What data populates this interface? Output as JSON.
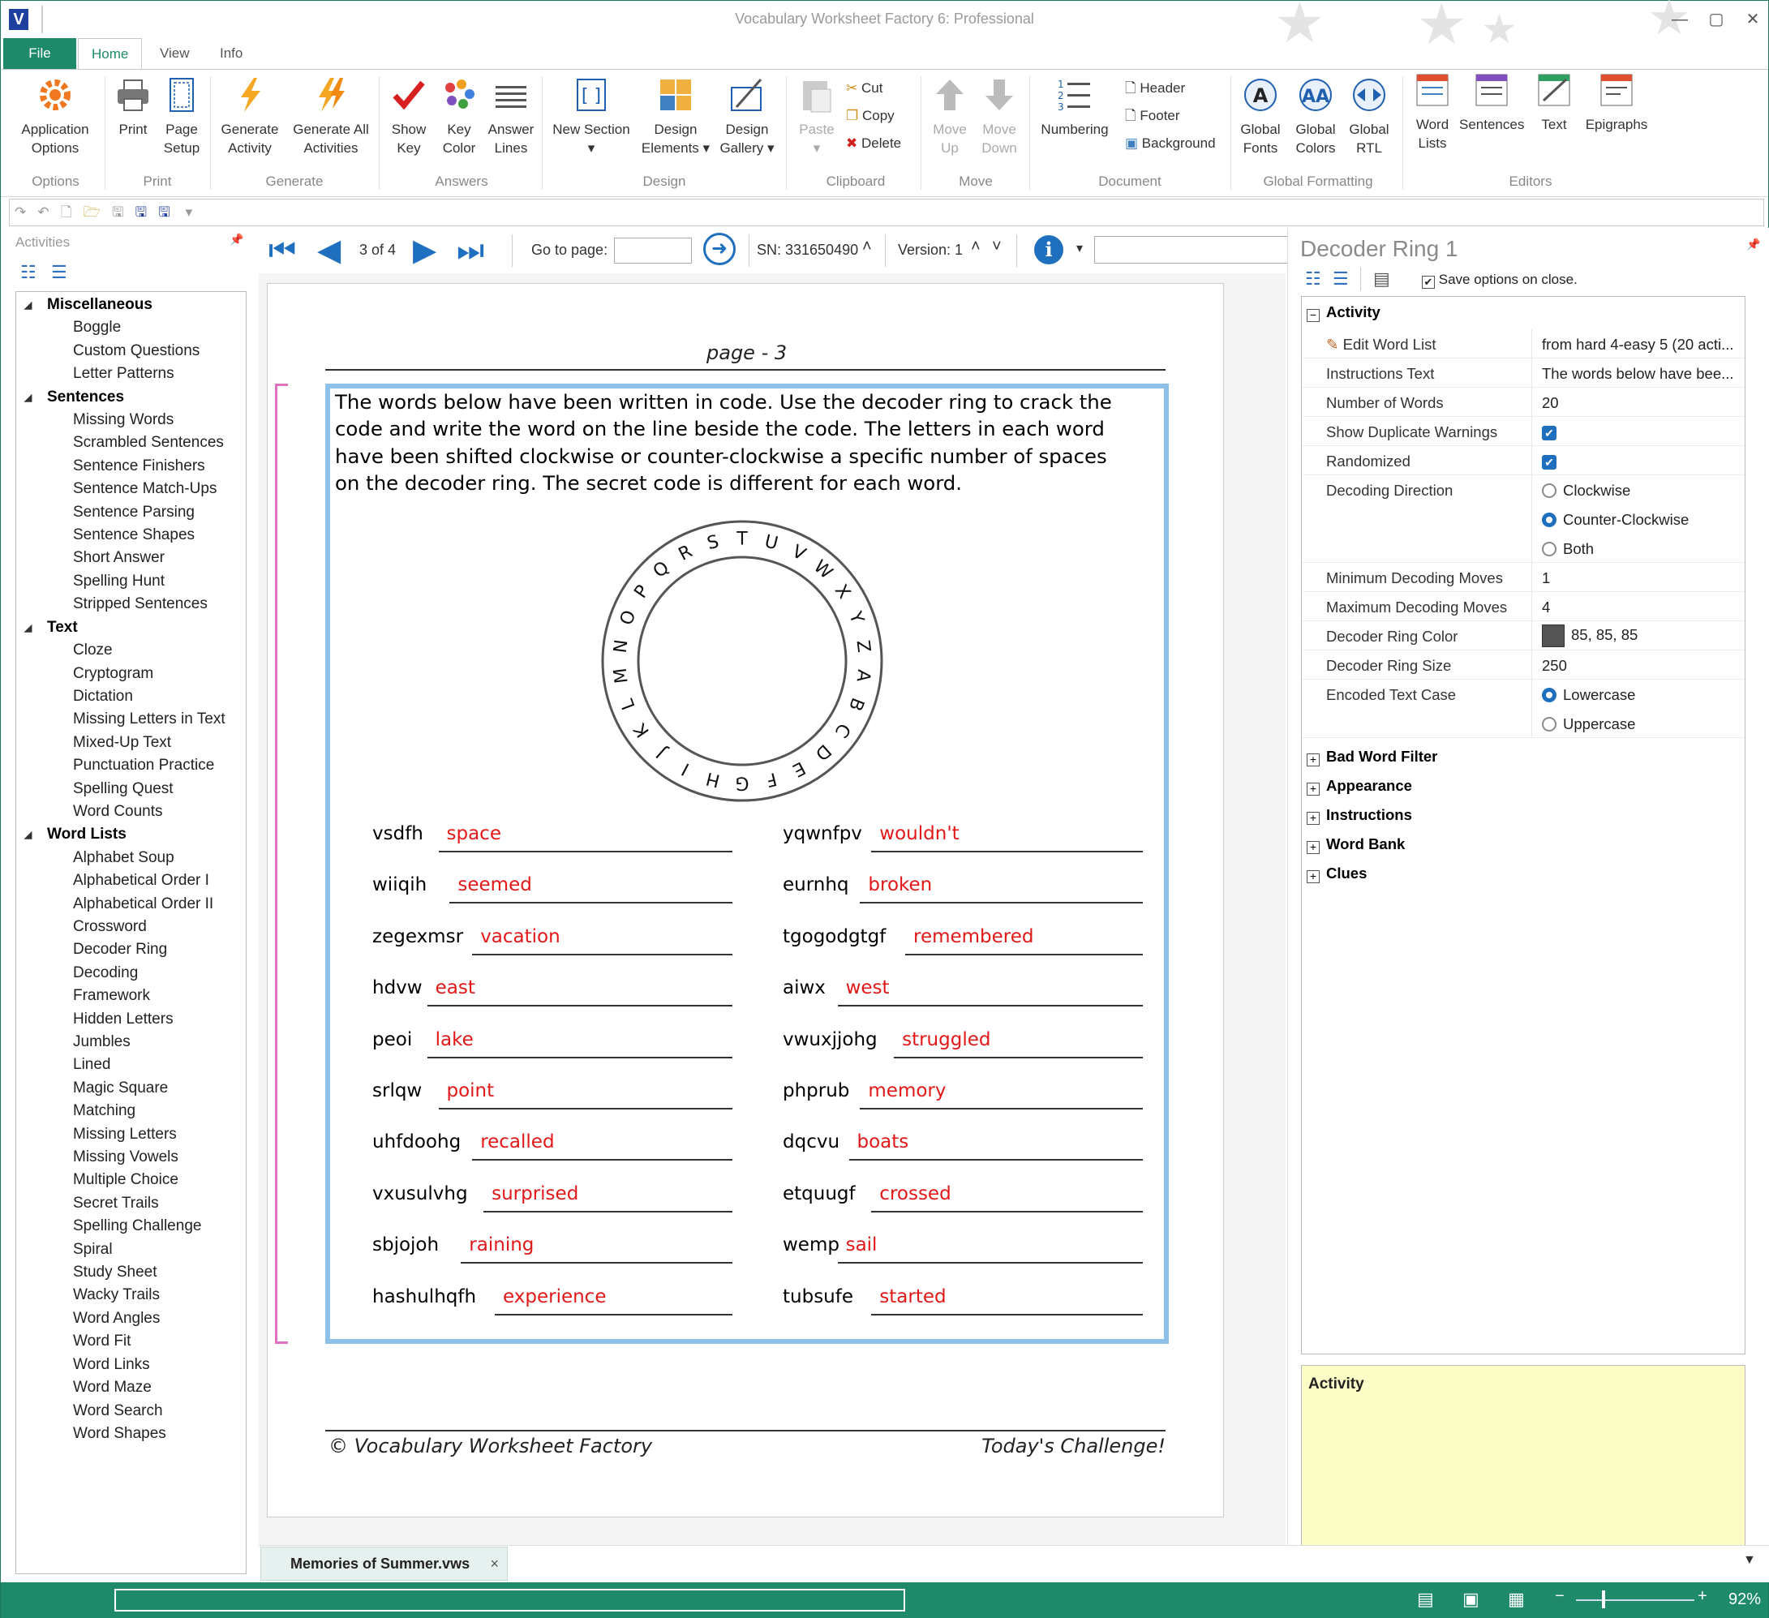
{
  "window": {
    "title": "Vocabulary Worksheet Factory 6: Professional",
    "logo": "V"
  },
  "menu_tabs": [
    "File",
    "Home",
    "View",
    "Info"
  ],
  "ribbon": {
    "groups": [
      "Options",
      "Print",
      "Generate",
      "Answers",
      "Design",
      "Clipboard",
      "Move",
      "Document",
      "Global Formatting",
      "Editors"
    ],
    "application_options": "Application Options",
    "print": "Print",
    "page_setup": "Page Setup",
    "generate_activity": "Generate Activity",
    "generate_all": "Generate All Activities",
    "show_key": "Show Key",
    "key_color": "Key Color",
    "answer_lines": "Answer Lines",
    "new_section": "New Section",
    "design_elements": "Design Elements",
    "design_gallery": "Design Gallery",
    "paste": "Paste",
    "cut": "Cut",
    "copy": "Copy",
    "delete": "Delete",
    "move_up": "Move Up",
    "move_down": "Move Down",
    "numbering": "Numbering",
    "header": "Header",
    "footer": "Footer",
    "background": "Background",
    "global_fonts": "Global Fonts",
    "global_colors": "Global Colors",
    "global_rtl": "Global RTL",
    "word_lists": "Word Lists",
    "sentences": "Sentences",
    "text": "Text",
    "epigraphs": "Epigraphs"
  },
  "left_panel": {
    "header": "Activities",
    "categories": [
      {
        "name": "Miscellaneous",
        "items": [
          "Boggle",
          "Custom Questions",
          "Letter Patterns"
        ]
      },
      {
        "name": "Sentences",
        "items": [
          "Missing Words",
          "Scrambled Sentences",
          "Sentence Finishers",
          "Sentence Match-Ups",
          "Sentence Parsing",
          "Sentence Shapes",
          "Short Answer",
          "Spelling Hunt",
          "Stripped Sentences"
        ]
      },
      {
        "name": "Text",
        "items": [
          "Cloze",
          "Cryptogram",
          "Dictation",
          "Missing Letters in Text",
          "Mixed-Up Text",
          "Punctuation Practice",
          "Spelling Quest",
          "Word Counts"
        ]
      },
      {
        "name": "Word Lists",
        "items": [
          "Alphabet Soup",
          "Alphabetical Order I",
          "Alphabetical Order II",
          "Crossword",
          "Decoder Ring",
          "Decoding",
          "Framework",
          "Hidden Letters",
          "Jumbles",
          "Lined",
          "Magic Square",
          "Matching",
          "Missing Letters",
          "Missing Vowels",
          "Multiple Choice",
          "Secret Trails",
          "Spelling Challenge",
          "Spiral",
          "Study Sheet",
          "Wacky Trails",
          "Word Angles",
          "Word Fit",
          "Word Links",
          "Word Maze",
          "Word Search",
          "Word Shapes"
        ]
      }
    ]
  },
  "doc_toolbar": {
    "page_indicator": "3 of 4",
    "goto_label": "Go to page:",
    "goto_value": "",
    "serial": "SN: 331650490",
    "version": "Version: 1"
  },
  "page": {
    "title": "page - 3",
    "instructions": "The words below have been written in code. Use the decoder ring to crack the code and write the word on the line beside the code. The letters in each word have been shifted clockwise or counter-clockwise a specific number of spaces on the decoder ring. The secret code is different for each word.",
    "ring_letters": [
      "A",
      "B",
      "C",
      "D",
      "E",
      "F",
      "G",
      "H",
      "I",
      "J",
      "K",
      "L",
      "M",
      "N",
      "O",
      "P",
      "Q",
      "R",
      "S",
      "T",
      "U",
      "V",
      "W",
      "X",
      "Y",
      "Z"
    ],
    "words_left": [
      {
        "code": "vsdfh",
        "answer": "space"
      },
      {
        "code": "wiiqih",
        "answer": "seemed"
      },
      {
        "code": "zegexmsr",
        "answer": "vacation"
      },
      {
        "code": "hdvw",
        "answer": "east"
      },
      {
        "code": "peoi",
        "answer": "lake"
      },
      {
        "code": "srlqw",
        "answer": "point"
      },
      {
        "code": "uhfdoohg",
        "answer": "recalled"
      },
      {
        "code": "vxusulvhg",
        "answer": "surprised"
      },
      {
        "code": "sbjojoh",
        "answer": "raining"
      },
      {
        "code": "hashulhqfh",
        "answer": "experience"
      }
    ],
    "words_right": [
      {
        "code": "yqwnfpv",
        "answer": "wouldn't"
      },
      {
        "code": "eurnhq",
        "answer": "broken"
      },
      {
        "code": "tgogodgtgf",
        "answer": "remembered"
      },
      {
        "code": "aiwx",
        "answer": "west"
      },
      {
        "code": "vwuxjjohg",
        "answer": "struggled"
      },
      {
        "code": "phprub",
        "answer": "memory"
      },
      {
        "code": "dqcvu",
        "answer": "boats"
      },
      {
        "code": "etquugf",
        "answer": "crossed"
      },
      {
        "code": "wemp",
        "answer": "sail"
      },
      {
        "code": "tubsufe",
        "answer": "started"
      }
    ],
    "footer_left": "© Vocabulary Worksheet Factory",
    "footer_right": "Today's Challenge!"
  },
  "right_panel": {
    "title": "Decoder Ring 1",
    "save_options": "Save options on close.",
    "section_activity": "Activity",
    "edit_word_list": "Edit Word List",
    "edit_word_list_value": "from hard 4-easy 5 (20 acti...",
    "instructions_text": "Instructions Text",
    "instructions_value": "The words below have bee...",
    "number_of_words": "Number of Words",
    "number_of_words_value": "20",
    "show_dup": "Show Duplicate Warnings",
    "randomized": "Randomized",
    "decoding_direction": "Decoding Direction",
    "clockwise": "Clockwise",
    "counter_clockwise": "Counter-Clockwise",
    "both": "Both",
    "min_moves": "Minimum Decoding Moves",
    "min_moves_value": "1",
    "max_moves": "Maximum Decoding Moves",
    "max_moves_value": "4",
    "ring_color": "Decoder Ring Color",
    "ring_color_value": "85, 85, 85",
    "ring_color_hex": "#555555",
    "ring_size": "Decoder Ring Size",
    "ring_size_value": "250",
    "encoded_case": "Encoded Text Case",
    "lowercase": "Lowercase",
    "uppercase": "Uppercase",
    "sections": [
      "Bad Word Filter",
      "Appearance",
      "Instructions",
      "Word Bank",
      "Clues"
    ],
    "description_title": "Activity"
  },
  "doc_tab": {
    "name": "Memories of Summer.vws",
    "close": "×"
  },
  "status": {
    "zoom": "92%"
  },
  "colors": {
    "accent": "#1e8a6a",
    "answer": "#e21818",
    "box_border": "#8ec0e8",
    "nav": "#1f6fbf"
  }
}
